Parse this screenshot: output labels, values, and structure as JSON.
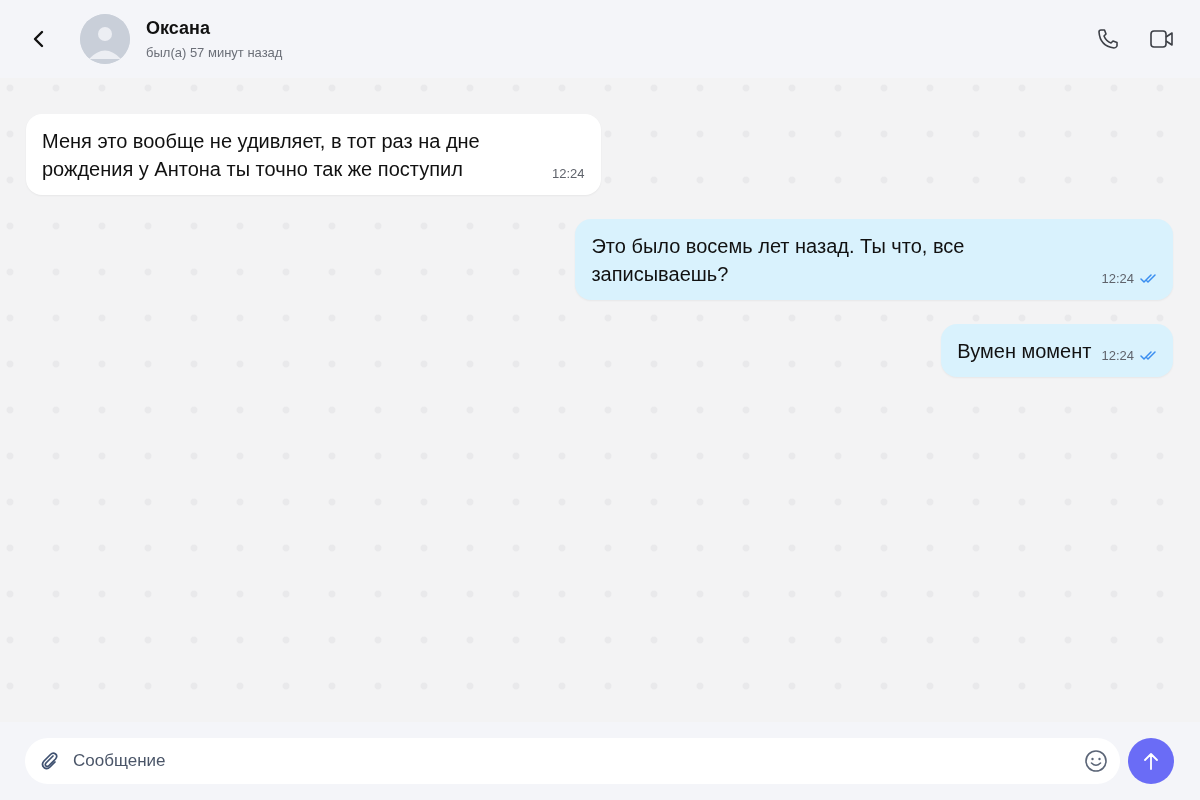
{
  "header": {
    "contact_name": "Оксана",
    "status": "был(а) 57 минут назад"
  },
  "messages": [
    {
      "kind": "incoming",
      "text": "Меня это вообще не удивляет, в тот раз на дне рождения у Антона ты точно так же поступил",
      "time": "12:24"
    },
    {
      "kind": "outgoing",
      "text": "Это было восемь лет назад. Ты что, все записываешь?",
      "time": "12:24",
      "read": true
    },
    {
      "kind": "outgoing",
      "text": "Вумен момент",
      "time": "12:24",
      "read": true
    }
  ],
  "composer": {
    "placeholder": "Сообщение"
  }
}
